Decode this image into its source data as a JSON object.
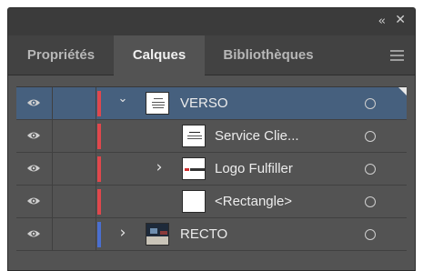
{
  "window": {
    "collapse_icon": "double-chevron-left-icon",
    "close_icon": "close-icon",
    "collapse_glyph": "‹‹",
    "close_glyph": "✕"
  },
  "tabs": [
    {
      "label": "Propriétés",
      "active": false
    },
    {
      "label": "Calques",
      "active": true
    },
    {
      "label": "Bibliothèques",
      "active": false
    }
  ],
  "menu_icon": "hamburger-menu-icon",
  "layers": [
    {
      "name": "VERSO",
      "depth": 0,
      "expanded": true,
      "selected": true,
      "color": "#e0474c",
      "thumbnail": "verso-thumbnail",
      "visible": true
    },
    {
      "name": "Service Clie...",
      "depth": 1,
      "expanded": null,
      "selected": false,
      "color": "#e0474c",
      "thumbnail": "service-client-thumbnail",
      "visible": true
    },
    {
      "name": "Logo Fulfiller",
      "depth": 1,
      "expanded": false,
      "selected": false,
      "color": "#e0474c",
      "thumbnail": "logo-fulfiller-thumbnail",
      "visible": true
    },
    {
      "name": "<Rectangle>",
      "depth": 1,
      "expanded": null,
      "selected": false,
      "color": "#e0474c",
      "thumbnail": "rectangle-thumbnail",
      "visible": true
    },
    {
      "name": "RECTO",
      "depth": 0,
      "expanded": false,
      "selected": false,
      "color": "#4a6fd0",
      "thumbnail": "recto-thumbnail",
      "visible": true
    }
  ],
  "glyphs": {
    "chevron_down": "⌄",
    "chevron_right": "›"
  },
  "colors": {
    "panel_bg": "#535353",
    "tab_bar_bg": "#424242",
    "selected_row": "#46607e",
    "verso_layer_color": "#e0474c",
    "recto_layer_color": "#4a6fd0"
  }
}
